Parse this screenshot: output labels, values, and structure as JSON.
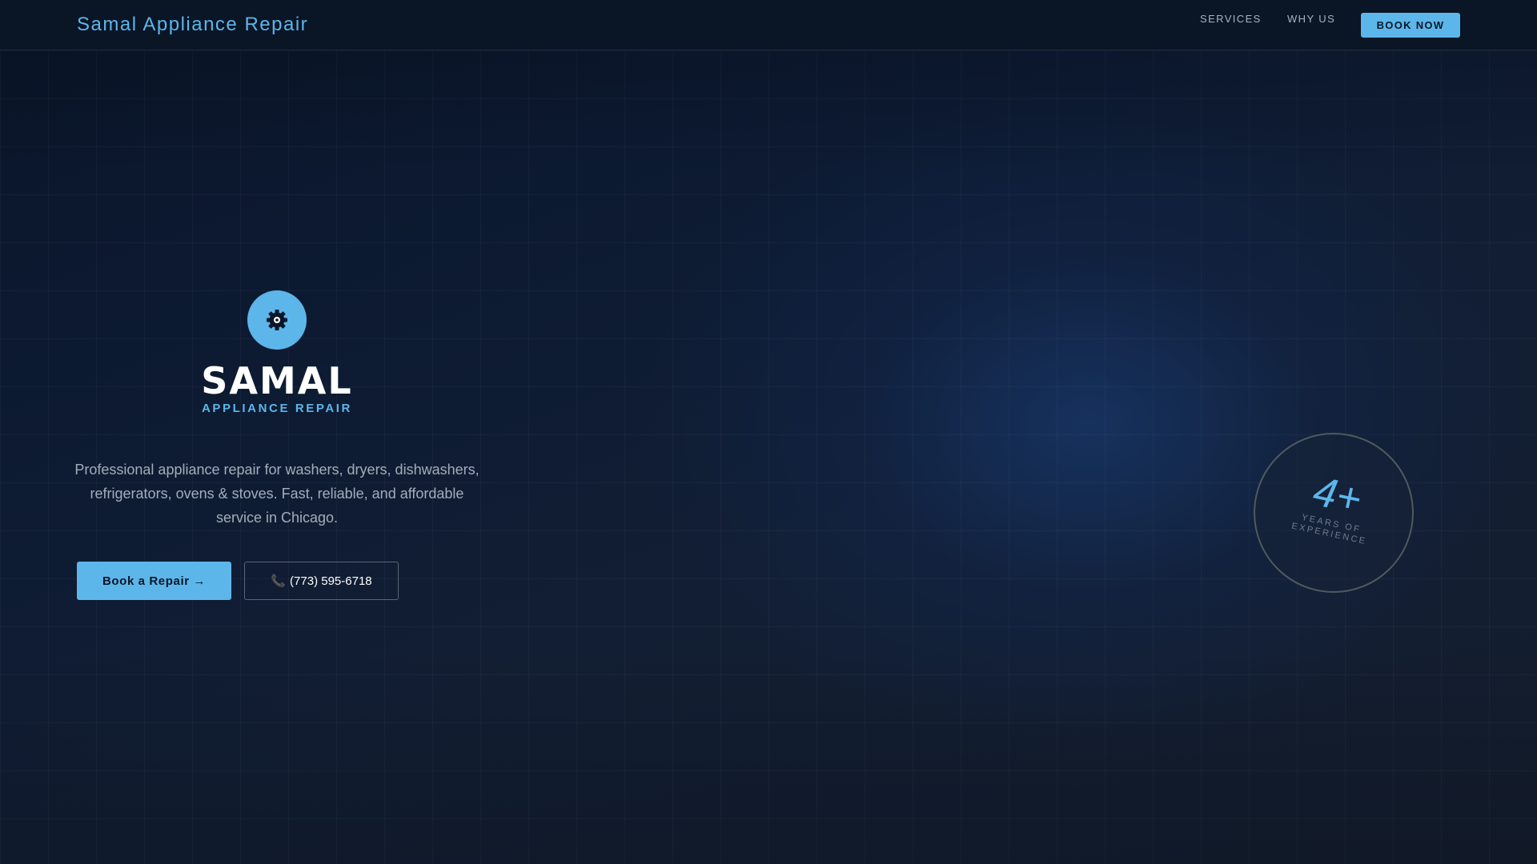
{
  "header": {
    "brand": "Samal Appliance Repair",
    "nav": [
      {
        "label": "SERVICES"
      },
      {
        "label": "WHY US"
      }
    ],
    "cta": "BOOK NOW"
  },
  "hero": {
    "logo_icon": "gear-icon",
    "logo_title": "SAMAL",
    "logo_subtitle": "APPLIANCE REPAIR",
    "description": "Professional appliance repair for washers, dryers, dishwashers, refrigerators, ovens & stoves. Fast, reliable, and affordable service in Chicago.",
    "primary_button": "Book a Repair →",
    "phone_button": "(773) 595-6718",
    "phone_icon": "phone-icon"
  },
  "badge": {
    "number": "4+",
    "label": "YEARS OF EXPERIENCE"
  },
  "colors": {
    "accent": "#5cb6ea",
    "background": "#0b1628",
    "text_muted": "#a3adbb"
  }
}
